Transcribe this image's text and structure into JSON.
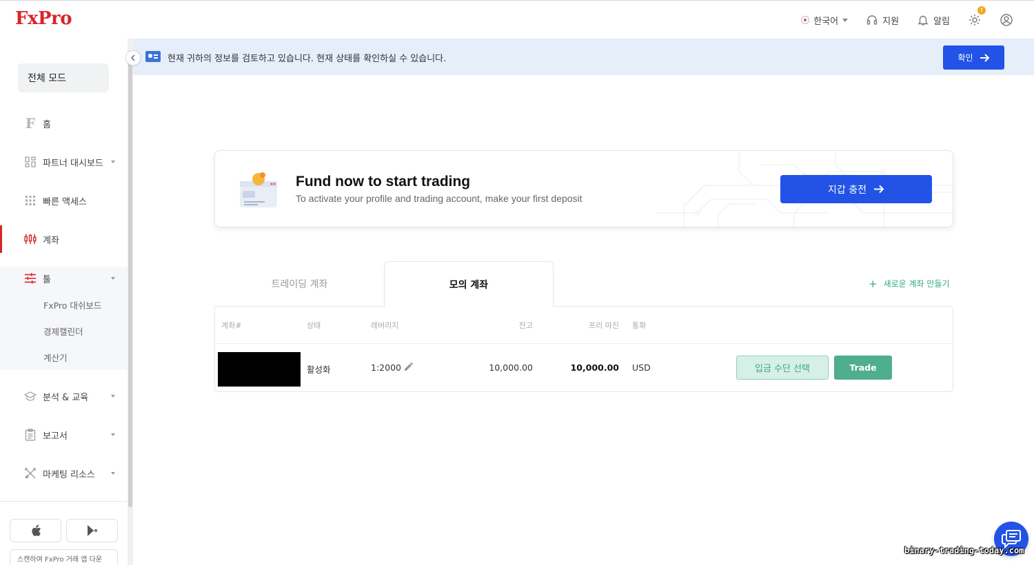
{
  "brand": {
    "logo": "FxPro",
    "accent": "#d6262a",
    "primary": "#2253e6",
    "green": "#4fae8e"
  },
  "header": {
    "language": "한국어",
    "support": "지원",
    "notifications": "알림",
    "settings_badge": "!"
  },
  "sidebar": {
    "mode_button": "전체 모드",
    "items": [
      {
        "label": "홈",
        "icon": "fxpro-f-icon"
      },
      {
        "label": "파트너 대시보드",
        "icon": "dashboard-icon"
      },
      {
        "label": "빠른 액세스",
        "icon": "grid-icon"
      },
      {
        "label": "계좌",
        "icon": "candlestick-icon"
      },
      {
        "label": "툴",
        "icon": "sliders-icon"
      },
      {
        "label": "분석 & 교육",
        "icon": "graduation-cap-icon"
      },
      {
        "label": "보고서",
        "icon": "clipboard-icon"
      },
      {
        "label": "마케팅 리소스",
        "icon": "tools-icon"
      }
    ],
    "tools_sub": [
      "FxPro 대쉬보드",
      "경제캘린더",
      "계산기"
    ],
    "qr_label": "스캔하여 FxPro 거래 앱 다운"
  },
  "notice": {
    "text": "현재 귀하의 정보를 검토하고 있습니다. 현재 상태를 확인하실 수 있습니다.",
    "button": "확인"
  },
  "fund": {
    "title": "Fund now to start trading",
    "subtitle": "To activate your profile and trading account, make your first deposit",
    "button": "지갑 충전"
  },
  "tabs": {
    "trading": "트레이딩 계좌",
    "demo": "모의 계좌",
    "new_account": "새로운 계좌 만들기"
  },
  "table": {
    "headers": {
      "account": "계좌#",
      "status": "상태",
      "leverage": "레버리지",
      "balance": "잔고",
      "free_margin": "프리 마진",
      "currency": "통화"
    },
    "row": {
      "status": "활성화",
      "leverage": "1:2000",
      "balance": "10,000.00",
      "free_margin": "10,000.00",
      "currency": "USD",
      "pay_button": "입금 수단 선택",
      "trade_button": "Trade"
    }
  },
  "watermark": "binary-trading-today.com"
}
